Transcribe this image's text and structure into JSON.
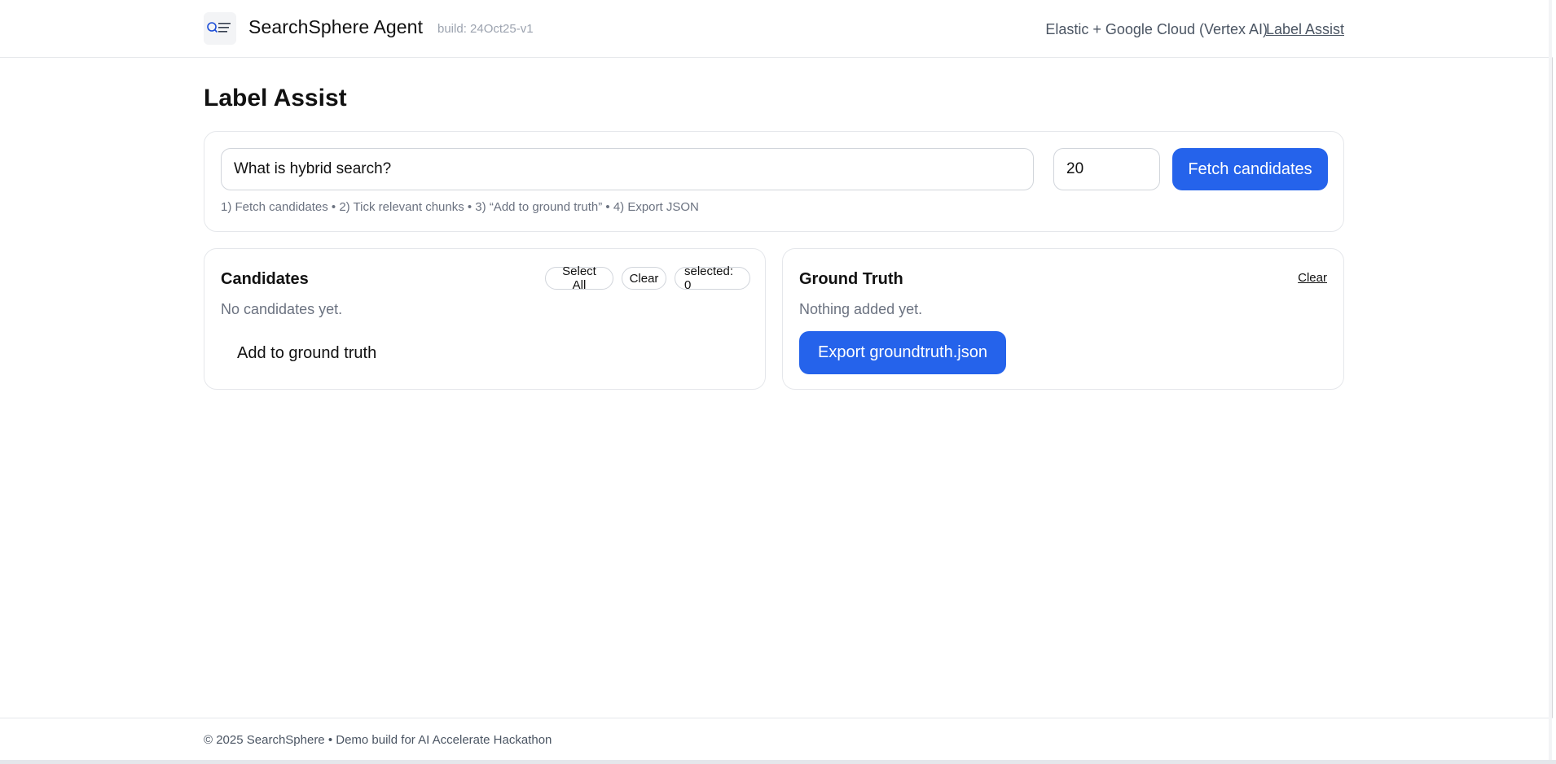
{
  "header": {
    "brand_title": "SearchSphere Agent",
    "build_tag": "build: 24Oct25-v1",
    "stack_text": "Elastic + Google Cloud (Vertex AI)",
    "nav_link": "Label Assist",
    "logo_icon": "searchsphere-logo-icon"
  },
  "main": {
    "page_title": "Label Assist",
    "query": {
      "value": "What is hybrid search?",
      "top_k": "20",
      "fetch_label": "Fetch candidates",
      "help_text": "1) Fetch candidates • 2) Tick relevant chunks • 3) “Add to ground truth” • 4) Export JSON"
    },
    "candidates": {
      "title": "Candidates",
      "select_all_label": "Select All",
      "clear_label": "Clear",
      "selected_count": "selected: 0",
      "empty_text": "No candidates yet.",
      "add_label": "Add to ground truth"
    },
    "ground_truth": {
      "title": "Ground Truth",
      "clear_label": "Clear",
      "empty_text": "Nothing added yet.",
      "export_label": "Export groundtruth.json"
    }
  },
  "footer": {
    "text": "© 2025 SearchSphere • Demo build for AI Accelerate Hackathon"
  },
  "colors": {
    "accent": "#2563eb",
    "border": "#e5e7eb",
    "muted_text": "#6b7280"
  }
}
